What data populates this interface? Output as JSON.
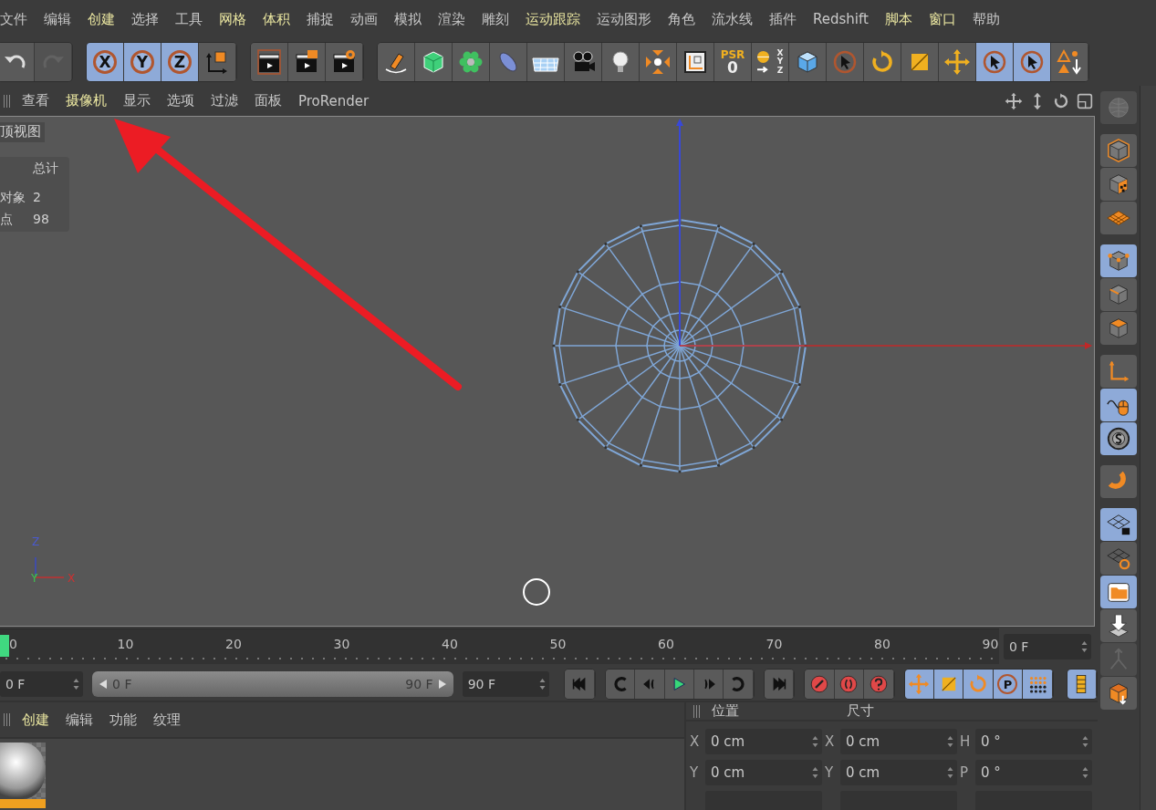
{
  "menu_bar": [
    {
      "label": "文件",
      "highlighted": false
    },
    {
      "label": "编辑",
      "highlighted": false
    },
    {
      "label": "创建",
      "highlighted": true
    },
    {
      "label": "选择",
      "highlighted": false
    },
    {
      "label": "工具",
      "highlighted": false
    },
    {
      "label": "网格",
      "highlighted": true
    },
    {
      "label": "体积",
      "highlighted": true
    },
    {
      "label": "捕捉",
      "highlighted": false
    },
    {
      "label": "动画",
      "highlighted": false
    },
    {
      "label": "模拟",
      "highlighted": false
    },
    {
      "label": "渲染",
      "highlighted": false
    },
    {
      "label": "雕刻",
      "highlighted": false
    },
    {
      "label": "运动跟踪",
      "highlighted": true
    },
    {
      "label": "运动图形",
      "highlighted": false
    },
    {
      "label": "角色",
      "highlighted": false
    },
    {
      "label": "流水线",
      "highlighted": false
    },
    {
      "label": "插件",
      "highlighted": false
    },
    {
      "label": "Redshift",
      "highlighted": false
    },
    {
      "label": "脚本",
      "highlighted": true
    },
    {
      "label": "窗口",
      "highlighted": true
    },
    {
      "label": "帮助",
      "highlighted": false
    }
  ],
  "toolbar": [
    [
      {
        "selected": false,
        "disabled": false
      },
      {
        "selected": false,
        "disabled": true
      }
    ],
    [
      {
        "labels": [
          "X"
        ],
        "selected": true,
        "disabled": false
      },
      {
        "labels": [
          "Y"
        ],
        "selected": true,
        "disabled": false
      },
      {
        "labels": [
          "Z"
        ],
        "selected": true,
        "disabled": false
      },
      {
        "selected": false,
        "disabled": false
      }
    ],
    [
      {
        "selected": false,
        "disabled": false
      },
      {
        "selected": false,
        "disabled": false
      },
      {
        "selected": false,
        "disabled": false
      }
    ],
    [
      {
        "selected": false,
        "disabled": false
      },
      {
        "selected": false,
        "disabled": false
      },
      {
        "selected": false,
        "disabled": false
      },
      {
        "selected": false,
        "disabled": false
      },
      {
        "selected": false,
        "disabled": false
      },
      {
        "selected": false,
        "disabled": false
      },
      {
        "selected": false,
        "disabled": false
      },
      {
        "selected": false,
        "disabled": false
      },
      {
        "selected": false,
        "disabled": false
      },
      {
        "labels": [
          "PSR",
          "0"
        ],
        "selected": false,
        "disabled": false
      },
      {
        "labels": [
          "X",
          "Y",
          "Z"
        ],
        "selected": false,
        "disabled": false
      },
      {
        "selected": false,
        "disabled": false
      },
      {
        "selected": false,
        "disabled": false
      },
      {
        "selected": false,
        "disabled": false
      },
      {
        "selected": false,
        "disabled": false
      },
      {
        "selected": false,
        "disabled": false
      },
      {
        "selected": true,
        "disabled": false
      },
      {
        "selected": true,
        "disabled": false
      },
      {
        "selected": false,
        "disabled": false
      }
    ]
  ],
  "viewport": {
    "menu": [
      {
        "label": "查看",
        "highlighted": false
      },
      {
        "label": "摄像机",
        "highlighted": true
      },
      {
        "label": "显示",
        "highlighted": false
      },
      {
        "label": "选项",
        "highlighted": false
      },
      {
        "label": "过滤",
        "highlighted": false
      },
      {
        "label": "面板",
        "highlighted": false
      },
      {
        "label": "ProRender",
        "highlighted": false
      }
    ],
    "view_name": "顶视图",
    "stats": {
      "header": "总计",
      "rows": [
        {
          "label": "对象",
          "value": "2"
        },
        {
          "label": "点",
          "value": "98"
        }
      ]
    },
    "axis_gizmo": {
      "labels": [
        "Z",
        "Y",
        "X"
      ]
    }
  },
  "timeline": {
    "ticks": [
      "0",
      "10",
      "20",
      "30",
      "40",
      "50",
      "60",
      "70",
      "80",
      "90"
    ],
    "playhead": {
      "level": 0
    },
    "current_frame": "0 F",
    "start": "0 F",
    "range_start": "0 F",
    "range_end": "90 F",
    "range": {
      "level": 1
    },
    "end": "90 F",
    "transport": [
      {
        "selected": false
      },
      {
        "selected": false
      },
      {
        "selected": false
      },
      {
        "selected": false
      },
      {
        "selected": false
      },
      {
        "selected": false
      },
      {
        "selected": false
      }
    ],
    "record": [
      {
        "selected": false
      },
      {
        "selected": false
      },
      {
        "selected": false
      }
    ],
    "modes": [
      {
        "selected": true
      },
      {
        "selected": true
      },
      {
        "selected": true
      },
      {
        "labels": [
          "P"
        ],
        "selected": true
      },
      {
        "selected": true
      }
    ],
    "timeline_button": {
      "selected": true
    }
  },
  "material_manager": {
    "menu": [
      {
        "label": "创建",
        "highlighted": true
      },
      {
        "label": "编辑",
        "highlighted": false
      },
      {
        "label": "功能",
        "highlighted": false
      },
      {
        "label": "纹理",
        "highlighted": false
      }
    ],
    "materials": [
      {
        "selected": true
      }
    ]
  },
  "coordinates": {
    "headers": [
      "位置",
      "尺寸"
    ],
    "rows": [
      [
        {
          "axis": "X",
          "value": "0 cm"
        },
        {
          "axis": "X",
          "value": "0 cm"
        },
        {
          "axis": "H",
          "value": "0 °"
        }
      ],
      [
        {
          "axis": "Y",
          "value": "0 cm"
        },
        {
          "axis": "Y",
          "value": "0 cm"
        },
        {
          "axis": "P",
          "value": "0 °"
        }
      ]
    ]
  },
  "side_toolbar": [
    {
      "selected": false,
      "disabled": true
    },
    {
      "selected": false,
      "disabled": false
    },
    {
      "selected": false,
      "disabled": false
    },
    {
      "selected": false,
      "disabled": false
    },
    {
      "selected": true,
      "disabled": false
    },
    {
      "selected": false,
      "disabled": false
    },
    {
      "selected": false,
      "disabled": false
    },
    {
      "selected": false,
      "disabled": false
    },
    {
      "selected": true,
      "disabled": false
    },
    {
      "selected": true,
      "disabled": false
    },
    {
      "selected": false,
      "disabled": false
    },
    {
      "selected": true,
      "disabled": false
    },
    {
      "selected": false,
      "disabled": false
    },
    {
      "selected": true,
      "disabled": false
    },
    {
      "selected": false,
      "disabled": false
    },
    {
      "selected": false,
      "disabled": true
    },
    {
      "selected": false,
      "disabled": false
    }
  ]
}
